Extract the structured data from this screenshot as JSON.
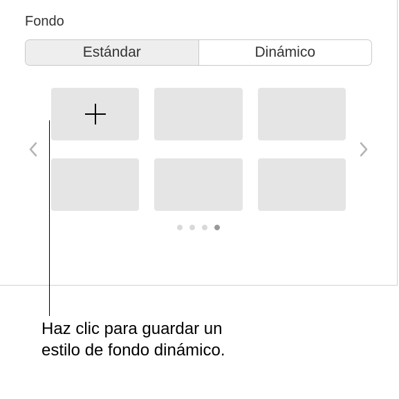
{
  "panel": {
    "title": "Fondo"
  },
  "tabs": {
    "standard": "Estándar",
    "dynamic": "Dinámico"
  },
  "callout": {
    "text": "Haz clic para guardar un estilo de fondo dinámico."
  },
  "pagination": {
    "total_pages": 4,
    "active_index": 3
  }
}
